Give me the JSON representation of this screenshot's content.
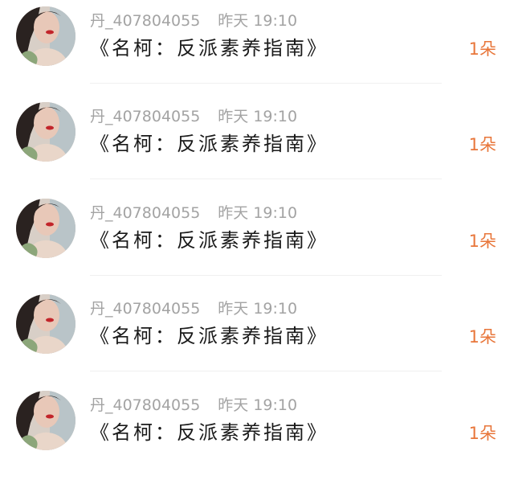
{
  "colors": {
    "username": "#a3a3a3",
    "title": "#1a1a1a",
    "count": "#e8763a",
    "divider": "#f0f0f0"
  },
  "items": [
    {
      "avatar_icon": "user-avatar-photo",
      "username": "丹_407804055",
      "time": "昨天 19:10",
      "title": "《名柯：反派素养指南》",
      "count": "1朵"
    },
    {
      "avatar_icon": "user-avatar-photo",
      "username": "丹_407804055",
      "time": "昨天 19:10",
      "title": "《名柯：反派素养指南》",
      "count": "1朵"
    },
    {
      "avatar_icon": "user-avatar-photo",
      "username": "丹_407804055",
      "time": "昨天 19:10",
      "title": "《名柯：反派素养指南》",
      "count": "1朵"
    },
    {
      "avatar_icon": "user-avatar-photo",
      "username": "丹_407804055",
      "time": "昨天 19:10",
      "title": "《名柯：反派素养指南》",
      "count": "1朵"
    },
    {
      "avatar_icon": "user-avatar-photo",
      "username": "丹_407804055",
      "time": "昨天 19:10",
      "title": "《名柯：反派素养指南》",
      "count": "1朵"
    }
  ]
}
